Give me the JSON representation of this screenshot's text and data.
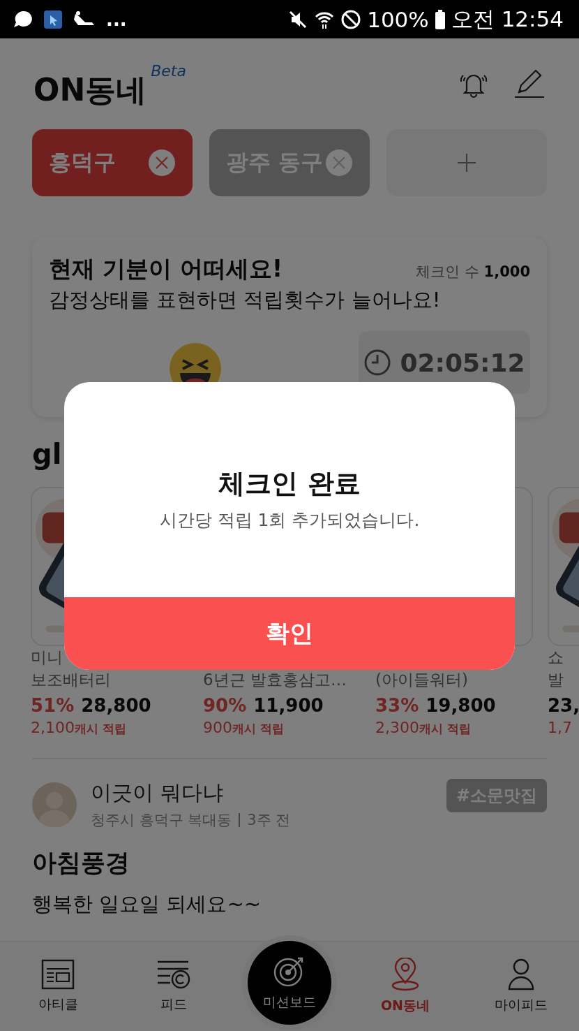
{
  "status_bar": {
    "more": "...",
    "battery": "100%",
    "time": "오전 12:54"
  },
  "header": {
    "title": "ON동네",
    "badge": "Beta"
  },
  "regions": [
    {
      "label": "흥덕구",
      "selected": true
    },
    {
      "label": "광주 동구",
      "selected": false
    }
  ],
  "mood_card": {
    "title": "현재 기분이 어떠세요!",
    "subtitle": "감정상태를 표현하면 적립횟수가 늘어나요!",
    "checkin_label": "체크인 수",
    "checkin_count": "1,000",
    "timer": "02:05:12"
  },
  "section_title": "gl",
  "products": [
    {
      "name_top": "미니",
      "name_bottom": "보조배터리",
      "discount": "51%",
      "price": "28,800",
      "cash": "2,100",
      "cash_label": "캐시 적립",
      "kind": "picture"
    },
    {
      "name_bottom": "6년근 발효홍삼고…",
      "discount": "90%",
      "price": "11,900",
      "cash": "900",
      "cash_label": "캐시 적립"
    },
    {
      "name_bottom": "(아이들워터)",
      "discount": "33%",
      "price": "19,800",
      "cash": "2,300",
      "cash_label": "캐시 적립"
    },
    {
      "name_top": "쇼",
      "name_bottom": "발",
      "price": "23,",
      "cash": "1,7",
      "kind": "picture"
    }
  ],
  "post": {
    "author": "이긋이 뭐다냐",
    "location": "청주시 흥덕구 복대동",
    "time": "3주 전",
    "tag": "#소문맛집",
    "title": "아침풍경",
    "body": "행복한 일요일 되세요~~"
  },
  "nav": [
    {
      "kind": "article",
      "label": "아티클",
      "selected": false
    },
    {
      "kind": "feed",
      "label": "피드",
      "selected": false
    },
    {
      "kind": "mission",
      "label": "미션보드",
      "selected": false
    },
    {
      "kind": "location",
      "label": "ON동네",
      "selected": true
    },
    {
      "kind": "person",
      "label": "마이피드",
      "selected": false
    }
  ],
  "dialog": {
    "title": "체크인 완료",
    "message": "시간당 적립 1회 추가되었습니다.",
    "button": "확인"
  }
}
